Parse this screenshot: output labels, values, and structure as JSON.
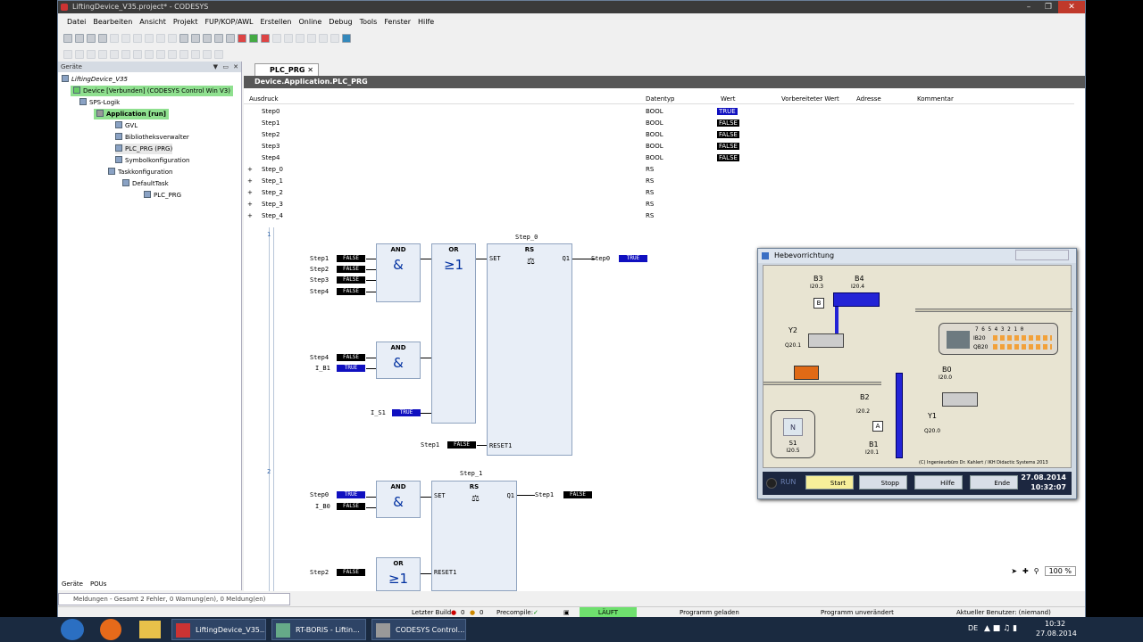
{
  "window": {
    "title": "LiftingDevice_V35.project* - CODESYS"
  },
  "menu": [
    "Datei",
    "Bearbeiten",
    "Ansicht",
    "Projekt",
    "FUP/KOP/AWL",
    "Erstellen",
    "Online",
    "Debug",
    "Tools",
    "Fenster",
    "Hilfe"
  ],
  "devices_panel": {
    "title": "Geräte",
    "tree": [
      {
        "label": "LiftingDevice_V35"
      },
      {
        "label": "Device [Verbunden] (CODESYS Control Win V3)"
      },
      {
        "label": "SPS-Logik"
      },
      {
        "label": "Application [run]"
      },
      {
        "label": "GVL"
      },
      {
        "label": "Bibliotheksverwalter"
      },
      {
        "label": "PLC_PRG (PRG)"
      },
      {
        "label": "Symbolkonfiguration"
      },
      {
        "label": "Taskkonfiguration"
      },
      {
        "label": "DefaultTask"
      },
      {
        "label": "PLC_PRG"
      }
    ],
    "tabs": [
      "Geräte",
      "POUs"
    ]
  },
  "editor": {
    "tab_label": "PLC_PRG",
    "path": "Device.Application.PLC_PRG",
    "columns": [
      "Ausdruck",
      "Datentyp",
      "Wert",
      "Vorbereiteter Wert",
      "Adresse",
      "Kommentar"
    ],
    "rows": [
      {
        "name": "Step0",
        "type": "BOOL",
        "value": "TRUE"
      },
      {
        "name": "Step1",
        "type": "BOOL",
        "value": "FALSE"
      },
      {
        "name": "Step2",
        "type": "BOOL",
        "value": "FALSE"
      },
      {
        "name": "Step3",
        "type": "BOOL",
        "value": "FALSE"
      },
      {
        "name": "Step4",
        "type": "BOOL",
        "value": "FALSE"
      },
      {
        "name": "Step_0",
        "type": "RS",
        "value": ""
      },
      {
        "name": "Step_1",
        "type": "RS",
        "value": ""
      },
      {
        "name": "Step_2",
        "type": "RS",
        "value": ""
      },
      {
        "name": "Step_3",
        "type": "RS",
        "value": ""
      },
      {
        "name": "Step_4",
        "type": "RS",
        "value": ""
      }
    ]
  },
  "fbd": {
    "network1": "1",
    "network2": "2",
    "and": "AND",
    "or": "OR",
    "rs": "RS",
    "set": "SET",
    "reset": "RESET1",
    "q1": "Q1",
    "and_sym": "&",
    "or_sym": "≥1",
    "step_0": "Step_0",
    "step_1": "Step_1",
    "inputs1": [
      "Step1",
      "Step2",
      "Step3",
      "Step4"
    ],
    "inputs1_vals": [
      "FALSE",
      "FALSE",
      "FALSE",
      "FALSE"
    ],
    "inputs2": [
      "Step4",
      "I_B1"
    ],
    "inputs2_vals": [
      "FALSE",
      "TRUE"
    ],
    "is1": "I_S1",
    "is1_val": "TRUE",
    "reset_in": "Step1",
    "reset_in_val": "FALSE",
    "out0": "Step0",
    "out0_val": "TRUE",
    "n2_inputs": [
      "Step0",
      "I_B0"
    ],
    "n2_vals": [
      "TRUE",
      "FALSE"
    ],
    "out1": "Step1",
    "out1_val": "FALSE",
    "n2_step2": "Step2",
    "n2_step2_val": "FALSE"
  },
  "sim": {
    "title": "Hebevorrichtung",
    "labels": {
      "b3": "B3",
      "b3a": "I20.3",
      "b4": "B4",
      "b4a": "I20.4",
      "y2": "Y2",
      "y2a": "Q20.1",
      "b0": "B0",
      "b0a": "I20.0",
      "b2": "B2",
      "b2a": "I20.2",
      "b1": "B1",
      "b1a": "I20.1",
      "y1": "Y1",
      "y1a": "Q20.0",
      "s1": "S1",
      "s1a": "I20.5",
      "ib": "IB20",
      "qb": "QB20",
      "bits": "7 6 5 4 3 2 1 0",
      "boxb": "B",
      "boxa": "A",
      "n": "N"
    },
    "credit": "(C) Ingenieurbüro Dr. Kahlert / IKH Didactic Systems 2013",
    "run": "RUN",
    "buttons": [
      "Start",
      "Stopp",
      "Hilfe",
      "Ende"
    ],
    "date": "27.08.2014",
    "time": "10:32:07"
  },
  "status": {
    "messages": "Meldungen - Gesamt 2 Fehler, 0 Warnung(en), 0 Meldung(en)",
    "last_build": "Letzter Build",
    "err": "0",
    "warn": "0",
    "precompile": "Precompile:",
    "running": "LÄUFT",
    "loaded": "Programm geladen",
    "unchanged": "Programm unverändert",
    "user": "Aktueller Benutzer: (niemand)",
    "zoom": "100 %"
  },
  "taskbar": {
    "items": [
      "LiftingDevice_V35...",
      "RT-BORIS - Liftin...",
      "CODESYS Control..."
    ],
    "lang": "DE",
    "time": "10:32",
    "date": "27.08.2014"
  }
}
